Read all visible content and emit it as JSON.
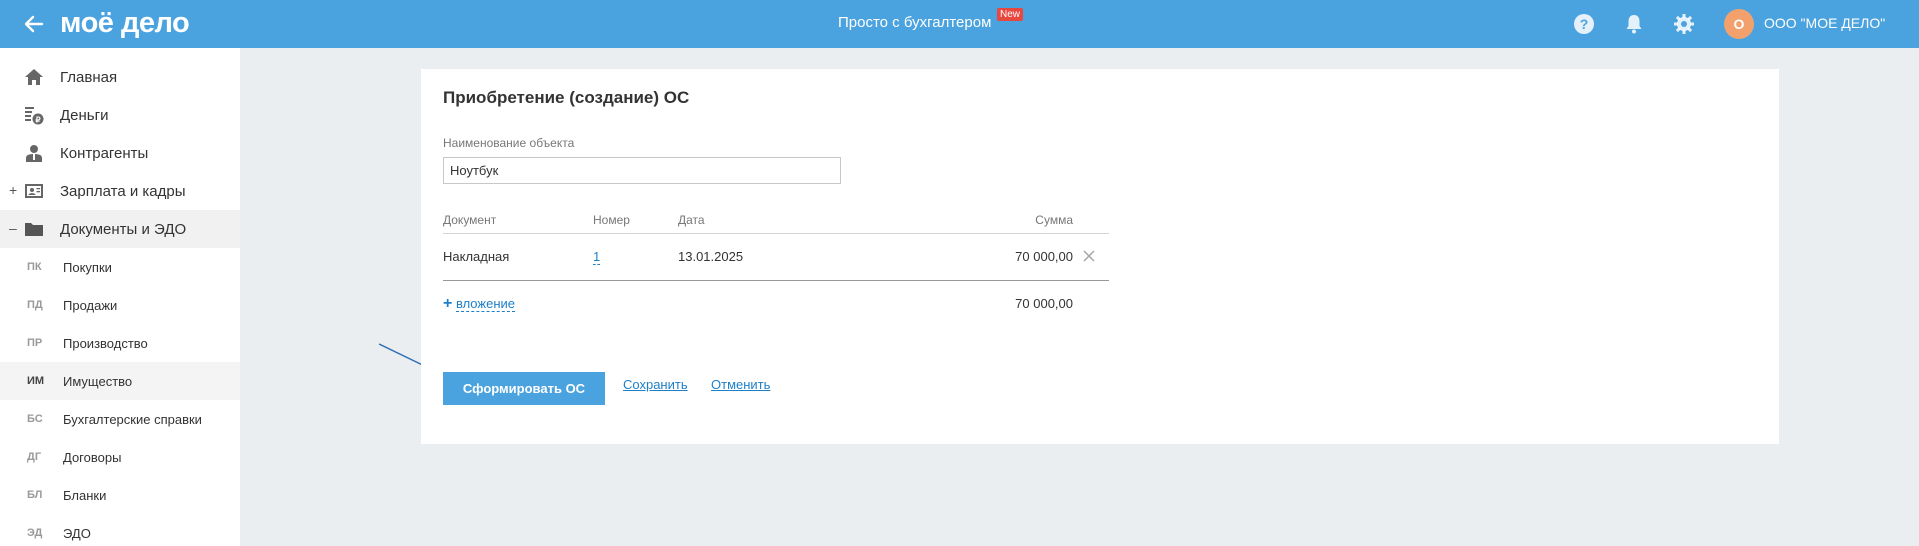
{
  "header": {
    "logo": "моё дело",
    "center_title": "Просто с бухгалтером",
    "new_badge": "New",
    "avatar_letter": "О",
    "company_name": "ООО \"МОЕ ДЕЛО\"",
    "bg_color": "#4aa3df",
    "icons": [
      "back-arrow-icon",
      "help-icon",
      "bell-icon",
      "gear-icon"
    ]
  },
  "sidebar": {
    "items": [
      {
        "label": "Главная",
        "icon": "home-icon",
        "toggle": ""
      },
      {
        "label": "Деньги",
        "icon": "money-icon",
        "toggle": ""
      },
      {
        "label": "Контрагенты",
        "icon": "contractors-icon",
        "toggle": ""
      },
      {
        "label": "Зарплата и кадры",
        "icon": "salary-icon",
        "toggle": "+"
      },
      {
        "label": "Документы и ЭДО",
        "icon": "folder-icon",
        "toggle": "–"
      }
    ],
    "subitems": [
      {
        "abbr": "ПК",
        "label": "Покупки"
      },
      {
        "abbr": "ПД",
        "label": "Продажи"
      },
      {
        "abbr": "ПР",
        "label": "Производство"
      },
      {
        "abbr": "ИМ",
        "label": "Имущество"
      },
      {
        "abbr": "БС",
        "label": "Бухгалтерские справки"
      },
      {
        "abbr": "ДГ",
        "label": "Договоры"
      },
      {
        "abbr": "БЛ",
        "label": "Бланки"
      },
      {
        "abbr": "ЭД",
        "label": "ЭДО"
      }
    ]
  },
  "main": {
    "title": "Приобретение (создание) ОС",
    "name_label": "Наименование объекта",
    "name_value": "Ноутбук",
    "table": {
      "headers": {
        "document": "Документ",
        "number": "Номер",
        "date": "Дата",
        "sum": "Сумма"
      },
      "rows": [
        {
          "document": "Накладная",
          "number": "1",
          "date": "13.01.2025",
          "sum": "70 000,00"
        }
      ],
      "add_plus": "+",
      "add_label": "вложение",
      "total": "70 000,00"
    },
    "buttons": {
      "primary": "Сформировать ОС",
      "save": "Сохранить",
      "cancel": "Отменить"
    }
  }
}
